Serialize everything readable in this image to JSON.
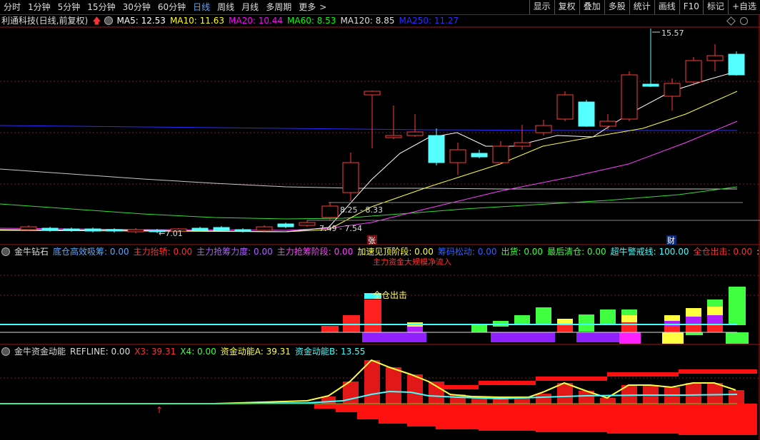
{
  "topbar": {
    "tabs": [
      "分时",
      "1分钟",
      "5分钟",
      "15分钟",
      "30分钟",
      "60分钟",
      "日线",
      "周线",
      "月线",
      "多周期",
      "更多"
    ],
    "active_tab": "日线",
    "more_arrow": ">",
    "right_buttons": [
      "显示",
      "复权",
      "叠加",
      "多股",
      "统计",
      "画线",
      "F10",
      "标记",
      "+自选"
    ]
  },
  "main_panel": {
    "title": "利通科技(日线,前复权)",
    "ma": [
      {
        "label": "MA5: 12.53",
        "color": "#ffffff"
      },
      {
        "label": "MA10: 11.63",
        "color": "#ffff00"
      },
      {
        "label": "MA20: 10.44",
        "color": "#ff00ff"
      },
      {
        "label": "MA60: 8.53",
        "color": "#00ff00"
      },
      {
        "label": "MA120: 8.85",
        "color": "#dddddd"
      },
      {
        "label": "MA250: 11.27",
        "color": "#2b2bff"
      }
    ],
    "annotations": {
      "high": "15.57",
      "range1": "8.25 - 8.33",
      "range2": "7.49 - 7.54",
      "low": "7.01",
      "zhang": "张",
      "cai": "财"
    }
  },
  "indicator1": {
    "name": "金牛钻石",
    "items": [
      {
        "label": "底仓高效吸筹: 0.00",
        "color": "#58a9ff"
      },
      {
        "label": "主力抬轿: 0.00",
        "color": "#ff3030"
      },
      {
        "label": "主力抢筹力度: 0.00",
        "color": "#b060ff"
      },
      {
        "label": "主力抢筹阶段: 0.00",
        "color": "#ff40ff"
      },
      {
        "label": "加速见顶阶段: 0.00",
        "color": "#ffff40"
      },
      {
        "label": "筹码松动: 0.00",
        "color": "#3060ff"
      },
      {
        "label": "出货: 0.00",
        "color": "#40ff40"
      },
      {
        "label": "最后清仓: 0.00",
        "color": "#40ff40"
      },
      {
        "label": "超牛警戒线: 100.00",
        "color": "#40ffff"
      },
      {
        "label": "全仓出击: 0.00",
        "color": "#ff3030"
      },
      {
        "label": ": 0.00",
        "color": "#dddddd"
      }
    ],
    "overlay_text": "全仓出击",
    "clipped_text": "主力资金大规模净流入"
  },
  "indicator2": {
    "name": "金牛资金动能",
    "items": [
      {
        "label": "REFLINE: 0.00",
        "color": "#dddddd"
      },
      {
        "label": "X3: 39.31",
        "color": "#ff3030"
      },
      {
        "label": "X4: 0.00",
        "color": "#40ff40"
      },
      {
        "label": "资金动能A: 39.31",
        "color": "#ffff40"
      },
      {
        "label": "资金动能B: 13.55",
        "color": "#40ffff"
      }
    ]
  },
  "colors": {
    "up": "#ff3b3b",
    "down": "#54ffff",
    "bg": "#000000",
    "grid": "#7a1f1f"
  }
}
